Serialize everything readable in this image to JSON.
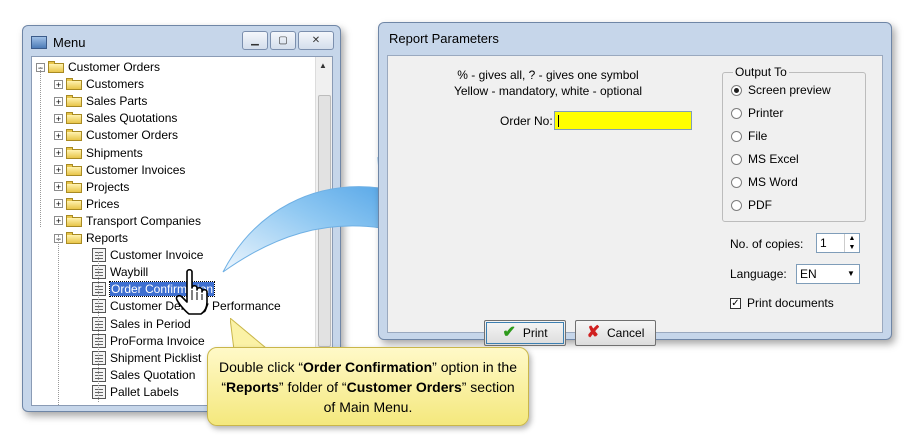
{
  "menu_window": {
    "title": "Menu",
    "icons": {
      "app": "window-app-icon",
      "minimize": "minimize-icon",
      "maximize": "maximize-icon",
      "close": "close-icon"
    },
    "tree": [
      {
        "label": "Customer Orders",
        "level": 0,
        "type": "folder",
        "expander": "−"
      },
      {
        "label": "Customers",
        "level": 1,
        "type": "folder",
        "expander": "+"
      },
      {
        "label": "Sales Parts",
        "level": 1,
        "type": "folder",
        "expander": "+"
      },
      {
        "label": "Sales Quotations",
        "level": 1,
        "type": "folder",
        "expander": "+"
      },
      {
        "label": "Customer Orders",
        "level": 1,
        "type": "folder",
        "expander": "+"
      },
      {
        "label": "Shipments",
        "level": 1,
        "type": "folder",
        "expander": "+"
      },
      {
        "label": "Customer Invoices",
        "level": 1,
        "type": "folder",
        "expander": "+"
      },
      {
        "label": "Projects",
        "level": 1,
        "type": "folder",
        "expander": "+"
      },
      {
        "label": "Prices",
        "level": 1,
        "type": "folder",
        "expander": "+"
      },
      {
        "label": "Transport Companies",
        "level": 1,
        "type": "folder",
        "expander": "+"
      },
      {
        "label": "Reports",
        "level": 1,
        "type": "folder",
        "expander": "−"
      },
      {
        "label": "Customer Invoice",
        "level": 2,
        "type": "report"
      },
      {
        "label": "Waybill",
        "level": 2,
        "type": "report"
      },
      {
        "label": "Order Confirmation",
        "level": 2,
        "type": "report",
        "selected": true
      },
      {
        "label": "Customer Delivery Performance",
        "level": 2,
        "type": "report"
      },
      {
        "label": "Sales in Period",
        "level": 2,
        "type": "report"
      },
      {
        "label": "ProForma Invoice",
        "level": 2,
        "type": "report"
      },
      {
        "label": "Shipment Picklist",
        "level": 2,
        "type": "report"
      },
      {
        "label": "Sales Quotation",
        "level": 2,
        "type": "report"
      },
      {
        "label": "Pallet Labels",
        "level": 2,
        "type": "report"
      }
    ]
  },
  "dialog": {
    "title": "Report Parameters",
    "hint_line1": "% - gives all, ? - gives one symbol",
    "hint_line2": "Yellow - mandatory, white - optional",
    "order_label": "Order No:",
    "order_value": "",
    "output_title": "Output To",
    "output_options": [
      "Screen preview",
      "Printer",
      "File",
      "MS Excel",
      "MS Word",
      "PDF"
    ],
    "output_selected": "Screen preview",
    "copies_label": "No. of copies:",
    "copies_value": "1",
    "language_label": "Language:",
    "language_value": "EN",
    "print_documents_label": "Print documents",
    "print_documents_checked": true,
    "print_button": "Print",
    "cancel_button": "Cancel"
  },
  "callout": {
    "t1": "Double click “",
    "b1": "Order Confirmation",
    "t2": "” option in the “",
    "b2": "Reports",
    "t3": "” folder of “",
    "b3": "Customer Orders",
    "t4": "” section of Main Menu."
  },
  "colors": {
    "mandatory_field": "#ffff00",
    "selection": "#3e6fd0",
    "callout_bg": "#fff6b0",
    "arrow": "#3aa0e8"
  }
}
